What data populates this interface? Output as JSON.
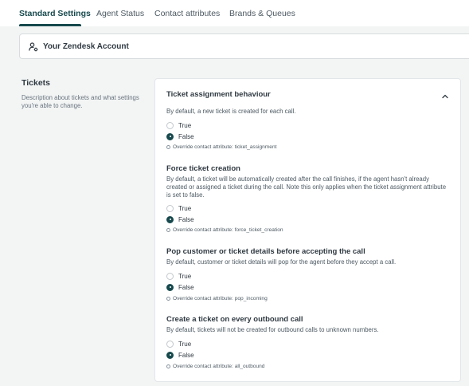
{
  "tabs": [
    {
      "label": "Standard Settings",
      "active": true
    },
    {
      "label": "Agent Status",
      "active": false
    },
    {
      "label": "Contact attributes",
      "active": false
    },
    {
      "label": "Brands & Queues",
      "active": false
    }
  ],
  "account": {
    "title": "Your Zendesk Account",
    "icon": "user-gear-icon"
  },
  "tickets": {
    "title": "Tickets",
    "description": "Description about tickets and what settings you're able to change."
  },
  "settings": [
    {
      "title": "Ticket assignment behaviour",
      "description": "By default, a new ticket is created for each call.",
      "options": [
        "True",
        "False"
      ],
      "selected": "False",
      "override": "Override contact attribute: ticket_assignment"
    },
    {
      "title": "Force ticket creation",
      "description": "By default, a ticket will be automatically created after the call finishes, if the agent hasn't already created or assigned a ticket during the call. Note this only applies when the ticket assignment attribute is set to false.",
      "options": [
        "True",
        "False"
      ],
      "selected": "False",
      "override": "Override contact attribute: force_ticket_creation"
    },
    {
      "title": "Pop customer or ticket details before accepting the call",
      "description": "By default, customer or ticket details will pop for the agent before they accept a call.",
      "options": [
        "True",
        "False"
      ],
      "selected": "False",
      "override": "Override contact attribute: pop_incoming"
    },
    {
      "title": "Create a ticket on every outbound call",
      "description": "By default, tickets will not be created for outbound calls to unknown numbers.",
      "options": [
        "True",
        "False"
      ],
      "selected": "False",
      "override": "Override contact attribute: all_outbound"
    }
  ],
  "colors": {
    "accent": "#17494d",
    "text": "#2f3941",
    "muted": "#68737d"
  }
}
